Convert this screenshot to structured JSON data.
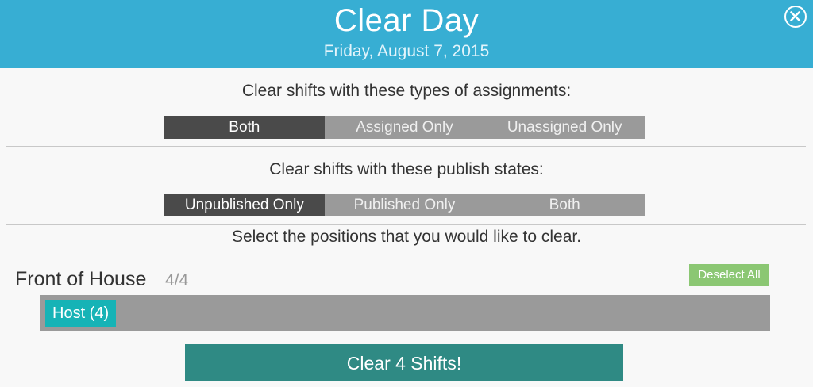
{
  "header": {
    "title": "Clear Day",
    "subtitle": "Friday, August 7, 2015",
    "close_icon": "close-circle-icon"
  },
  "assignment_section": {
    "prompt": "Clear shifts with these types of assignments:",
    "options": [
      "Both",
      "Assigned Only",
      "Unassigned Only"
    ],
    "selected": "Both"
  },
  "publish_section": {
    "prompt": "Clear shifts with these publish states:",
    "options": [
      "Unpublished Only",
      "Published Only",
      "Both"
    ],
    "selected": "Unpublished Only"
  },
  "positions_section": {
    "prompt": "Select the positions that you would like to clear.",
    "group": {
      "name": "Front of House",
      "count": "4/4",
      "deselect_label": "Deselect All",
      "positions": [
        {
          "label": "Host (4)",
          "selected": true
        }
      ]
    }
  },
  "action": {
    "clear_label": "Clear 4 Shifts!"
  },
  "colors": {
    "header": "#37aed3",
    "segment_active": "#4a4a4a",
    "segment_inactive": "#9a9a9a",
    "deselect": "#8bc773",
    "chip": "#16b3b6",
    "clear_button": "#2f8a84"
  }
}
